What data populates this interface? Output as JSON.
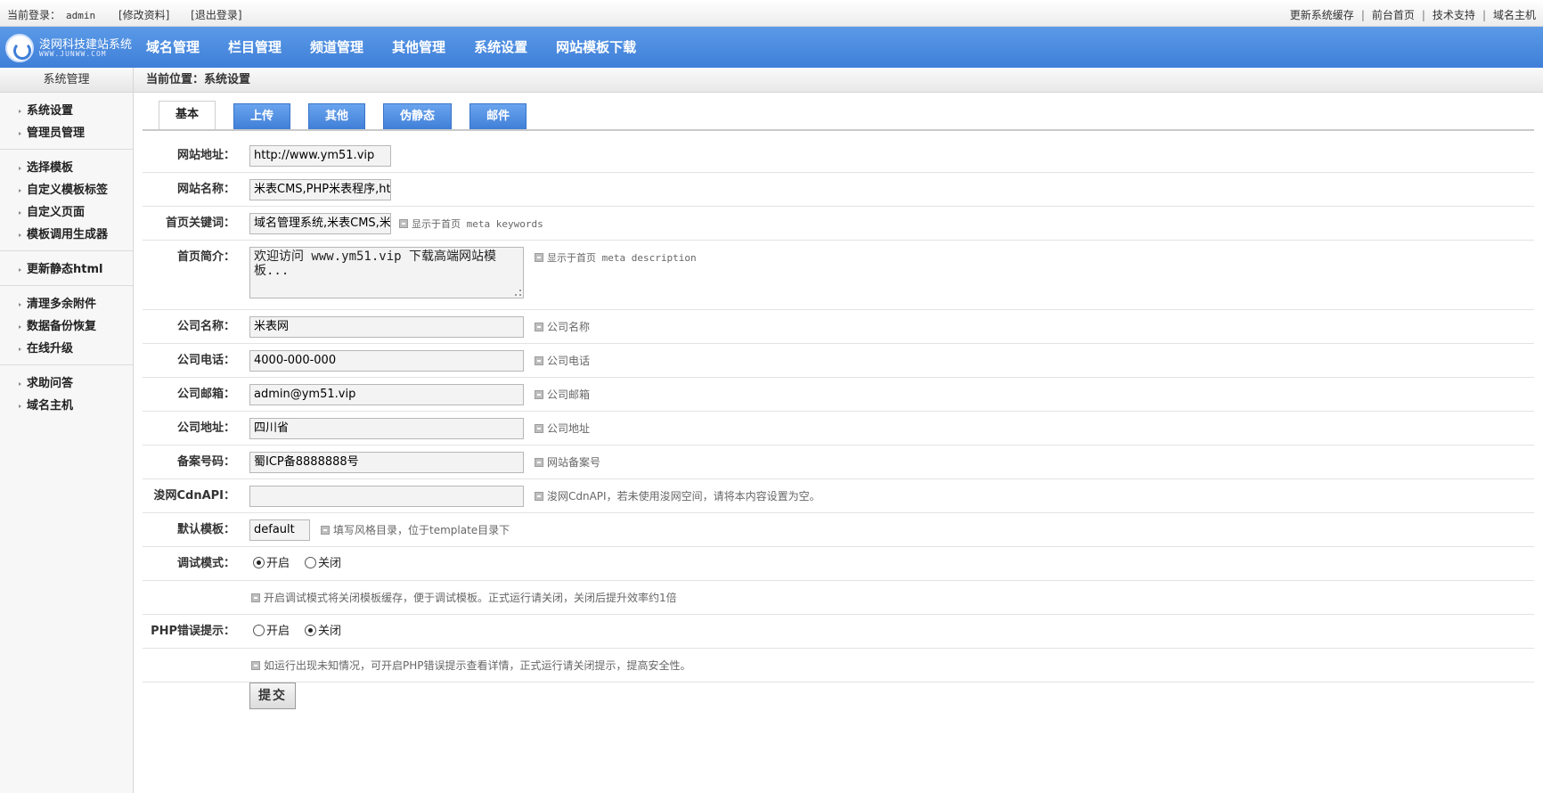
{
  "topbar": {
    "login_label": "当前登录：",
    "username": "admin",
    "edit_profile": "[修改资料]",
    "logout": "[退出登录]",
    "links": [
      "更新系统缓存",
      "前台首页",
      "技术支持",
      "域名主机"
    ]
  },
  "logo": {
    "text": "浚网科技建站系统",
    "sub": "WWW.JUNWW.COM"
  },
  "nav": [
    "域名管理",
    "栏目管理",
    "频道管理",
    "其他管理",
    "系统设置",
    "网站模板下载"
  ],
  "sidebar": {
    "title": "系统管理",
    "groups": [
      [
        "系统设置",
        "管理员管理"
      ],
      [
        "选择模板",
        "自定义模板标签",
        "自定义页面",
        "模板调用生成器"
      ],
      [
        "更新静态html"
      ],
      [
        "清理多余附件",
        "数据备份恢复",
        "在线升级"
      ],
      [
        "求助问答",
        "域名主机"
      ]
    ]
  },
  "breadcrumb": "当前位置：系统设置",
  "tabs": [
    "基本",
    "上传",
    "其他",
    "伪静态",
    "邮件"
  ],
  "form": {
    "site_url": {
      "label": "网站地址：",
      "value": "http://www.ym51.vip"
    },
    "site_name": {
      "label": "网站名称：",
      "value": "米表CMS,PHP米表程序,htm"
    },
    "keywords": {
      "label": "首页关键词：",
      "value": "域名管理系统,米表CMS,米",
      "hint": "显示于首页 meta keywords"
    },
    "description": {
      "label": "首页简介：",
      "value": "欢迎访问 www.ym51.vip 下载高端网站模板...",
      "hint": "显示于首页 meta description"
    },
    "company_name": {
      "label": "公司名称：",
      "value": "米表网",
      "hint": "公司名称"
    },
    "company_phone": {
      "label": "公司电话：",
      "value": "4000-000-000",
      "hint": "公司电话"
    },
    "company_email": {
      "label": "公司邮箱：",
      "value": "admin@ym51.vip",
      "hint": "公司邮箱"
    },
    "company_address": {
      "label": "公司地址：",
      "value": "四川省",
      "hint": "公司地址"
    },
    "icp": {
      "label": "备案号码：",
      "value": "蜀ICP备8888888号",
      "hint": "网站备案号"
    },
    "cdn_api": {
      "label": "浚网CdnAPI：",
      "value": "",
      "hint": "浚网CdnAPI，若未使用浚网空间，请将本内容设置为空。"
    },
    "template": {
      "label": "默认模板：",
      "value": "default",
      "hint": "填写风格目录，位于template目录下"
    },
    "debug": {
      "label": "调试模式：",
      "on": "开启",
      "off": "关闭",
      "selected": "on",
      "hint": "开启调试模式将关闭模板缓存，便于调试模板。正式运行请关闭，关闭后提升效率约1倍"
    },
    "php_error": {
      "label": "PHP错误提示：",
      "on": "开启",
      "off": "关闭",
      "selected": "off",
      "hint": "如运行出现未知情况，可开启PHP错误提示查看详情，正式运行请关闭提示，提高安全性。"
    },
    "submit": "提交"
  }
}
